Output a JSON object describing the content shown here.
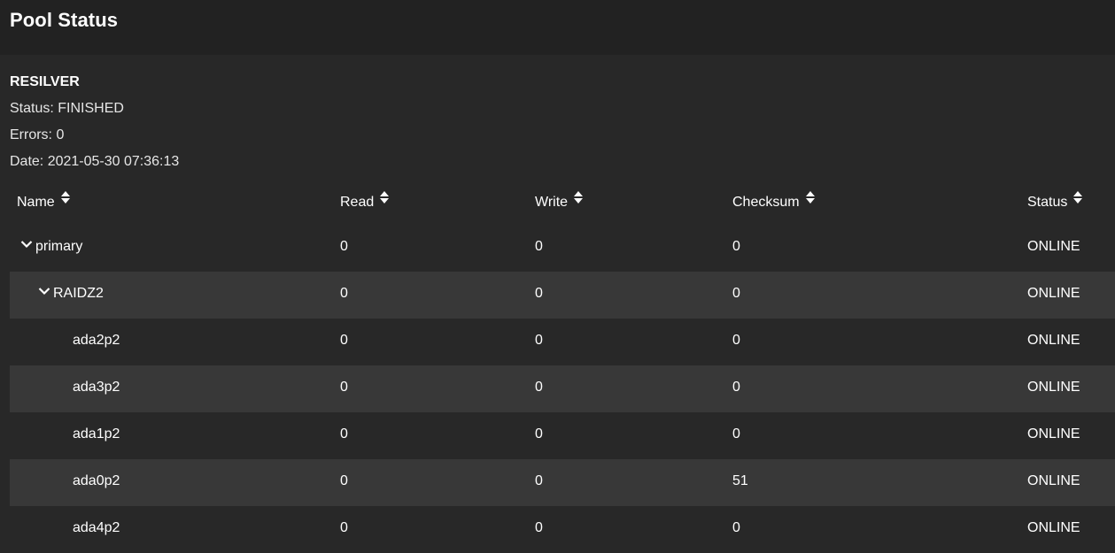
{
  "header": {
    "title": "Pool Status"
  },
  "resilver": {
    "heading": "RESILVER",
    "status": "Status: FINISHED",
    "errors": "Errors: 0",
    "date": "Date: 2021-05-30 07:36:13"
  },
  "table": {
    "columns": [
      "Name",
      "Read",
      "Write",
      "Checksum",
      "Status"
    ],
    "rows": [
      {
        "name": "primary",
        "read": "0",
        "write": "0",
        "checksum": "0",
        "status": "ONLINE",
        "level": 0,
        "expandable": true
      },
      {
        "name": "RAIDZ2",
        "read": "0",
        "write": "0",
        "checksum": "0",
        "status": "ONLINE",
        "level": 1,
        "expandable": true
      },
      {
        "name": "ada2p2",
        "read": "0",
        "write": "0",
        "checksum": "0",
        "status": "ONLINE",
        "level": 2,
        "expandable": false
      },
      {
        "name": "ada3p2",
        "read": "0",
        "write": "0",
        "checksum": "0",
        "status": "ONLINE",
        "level": 2,
        "expandable": false
      },
      {
        "name": "ada1p2",
        "read": "0",
        "write": "0",
        "checksum": "0",
        "status": "ONLINE",
        "level": 2,
        "expandable": false
      },
      {
        "name": "ada0p2",
        "read": "0",
        "write": "0",
        "checksum": "51",
        "status": "ONLINE",
        "level": 2,
        "expandable": false
      },
      {
        "name": "ada4p2",
        "read": "0",
        "write": "0",
        "checksum": "0",
        "status": "ONLINE",
        "level": 2,
        "expandable": false
      }
    ]
  },
  "icons": {
    "sort": "sort-icon",
    "expand": "chevron-down-icon"
  },
  "colors": {
    "background": "#282828",
    "header_bar": "#222222",
    "row_alt": "#383838"
  }
}
